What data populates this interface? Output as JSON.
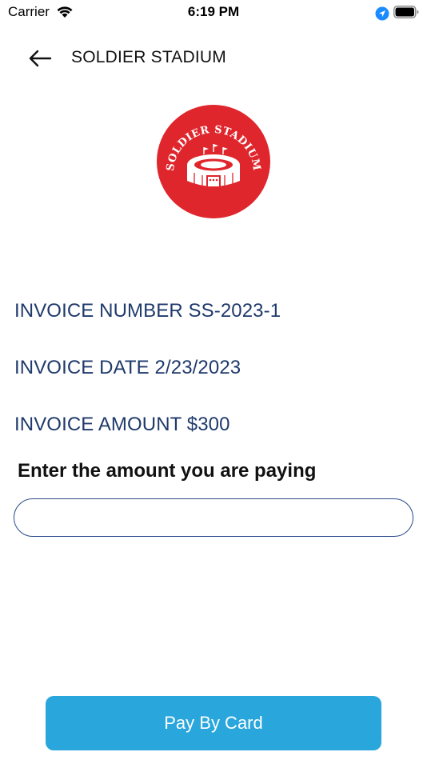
{
  "status_bar": {
    "carrier": "Carrier",
    "time": "6:19 PM",
    "icons": [
      "wifi-icon",
      "location-icon",
      "battery-icon"
    ]
  },
  "nav": {
    "title": "SOLDIER STADIUM",
    "back_icon": "arrow-left-icon"
  },
  "logo": {
    "text": "SOLDIER STADIUM",
    "color": "#e0262d"
  },
  "invoice": {
    "number": "INVOICE NUMBER SS-2023-1",
    "date": "INVOICE DATE 2/23/2023",
    "amount": "INVOICE AMOUNT $300"
  },
  "payment": {
    "prompt": "Enter the amount you are paying",
    "input_value": "",
    "input_placeholder": ""
  },
  "actions": {
    "pay_label": "Pay By Card"
  },
  "colors": {
    "accent": "#29a6dc",
    "info_text": "#1f3a6b",
    "input_border": "#2a4a8a",
    "logo_red": "#e0262d"
  }
}
